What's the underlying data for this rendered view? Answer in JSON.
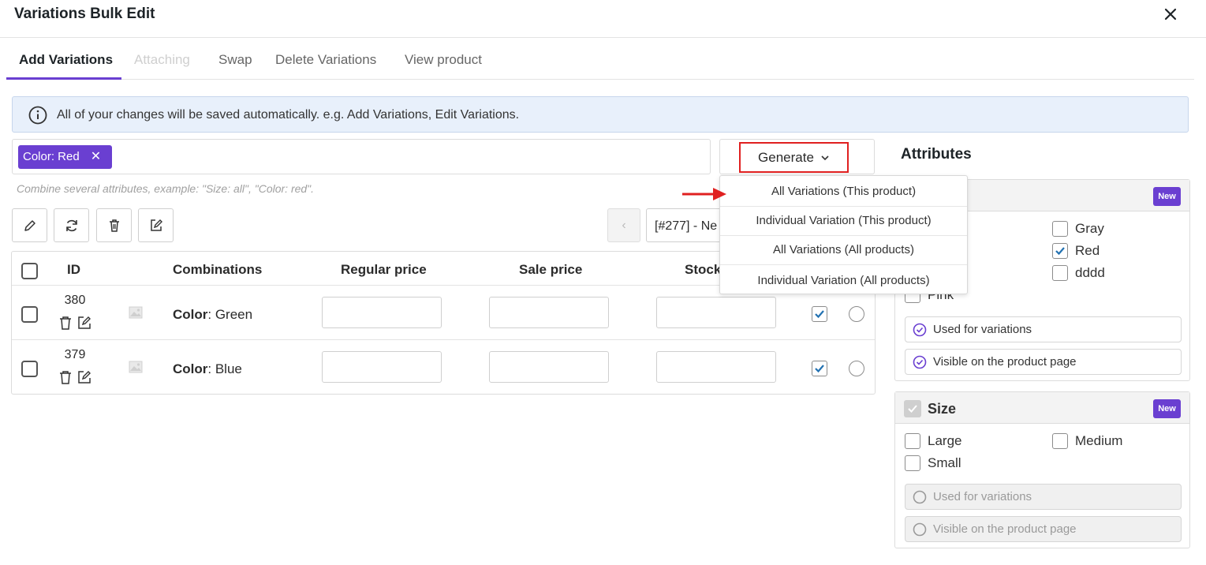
{
  "modal": {
    "title": "Variations Bulk Edit"
  },
  "tabs": [
    {
      "label": "Add Variations",
      "state": "active"
    },
    {
      "label": "Attaching",
      "state": "disabled"
    },
    {
      "label": "Swap",
      "state": "normal"
    },
    {
      "label": "Delete Variations",
      "state": "normal"
    },
    {
      "label": "View product",
      "state": "normal"
    }
  ],
  "info": {
    "text": "All of your changes will be saved automatically. e.g. Add Variations, Edit Variations."
  },
  "filter": {
    "chip_label": "Color: Red",
    "chip_remove": "✕",
    "hint": "Combine several attributes, example: \"Size: all\", \"Color: red\"."
  },
  "generate": {
    "label": "Generate",
    "menu": [
      "All Variations (This product)",
      "Individual Variation (This product)",
      "All Variations (All products)",
      "Individual Variation (All products)"
    ]
  },
  "toolbar": {
    "prev": "‹",
    "product_select": "[#277] - Ne"
  },
  "table": {
    "headers": {
      "id": "ID",
      "combinations": "Combinations",
      "regular_price": "Regular price",
      "sale_price": "Sale price",
      "stock": "Stock"
    },
    "rows": [
      {
        "id": "380",
        "attr_name": "Color",
        "attr_value": ": Green",
        "enabled": true
      },
      {
        "id": "379",
        "attr_name": "Color",
        "attr_value": ": Blue",
        "enabled": true
      }
    ]
  },
  "attributes": {
    "title": "Attributes",
    "new_badge": "New",
    "color_card": {
      "options": [
        {
          "label": "Gray",
          "checked": false
        },
        {
          "label": "Red",
          "checked": true
        },
        {
          "label": "dddd",
          "checked": false
        },
        {
          "label": "Pink",
          "checked": false
        }
      ],
      "used_for_variations": "Used for variations",
      "visible_on_page": "Visible on the product page"
    },
    "size_card": {
      "name": "Size",
      "options": [
        {
          "label": "Large",
          "checked": false
        },
        {
          "label": "Medium",
          "checked": false
        },
        {
          "label": "Small",
          "checked": false
        }
      ],
      "used_for_variations": "Used for variations",
      "visible_on_page": "Visible on the product page"
    }
  },
  "colors": {
    "accent": "#6a3fd1",
    "highlight_red": "#e02020",
    "info_bg": "#e8f0fb",
    "check_blue": "#2271b1"
  }
}
